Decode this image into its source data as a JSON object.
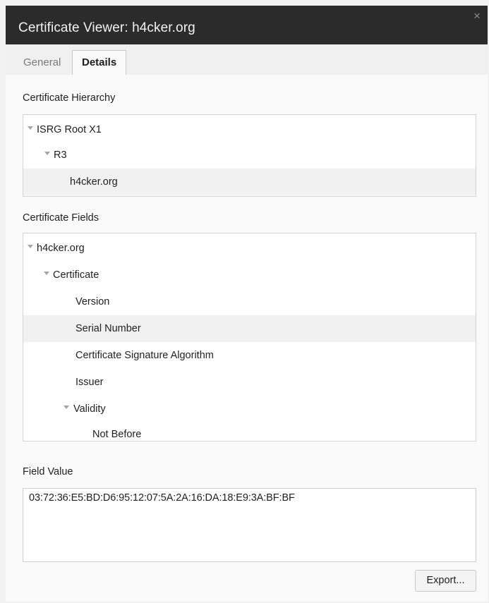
{
  "window": {
    "title": "Certificate Viewer: h4cker.org",
    "close_glyph": "×"
  },
  "tabs": [
    {
      "label": "General",
      "active": false
    },
    {
      "label": "Details",
      "active": true
    }
  ],
  "hierarchy": {
    "label": "Certificate Hierarchy",
    "items": [
      {
        "label": "ISRG Root X1",
        "expanded": true,
        "selected": false
      },
      {
        "label": "R3",
        "expanded": true,
        "selected": false
      },
      {
        "label": "h4cker.org",
        "expanded": false,
        "selected": true
      }
    ]
  },
  "fields": {
    "label": "Certificate Fields",
    "items": [
      {
        "label": "h4cker.org",
        "expanded": true,
        "selected": false
      },
      {
        "label": "Certificate",
        "expanded": true,
        "selected": false
      },
      {
        "label": "Version",
        "expanded": false,
        "selected": false
      },
      {
        "label": "Serial Number",
        "expanded": false,
        "selected": true
      },
      {
        "label": "Certificate Signature Algorithm",
        "expanded": false,
        "selected": false
      },
      {
        "label": "Issuer",
        "expanded": false,
        "selected": false
      },
      {
        "label": "Validity",
        "expanded": true,
        "selected": false
      },
      {
        "label": "Not Before",
        "expanded": false,
        "selected": false
      }
    ]
  },
  "field_value": {
    "label": "Field Value",
    "value": "03:72:36:E5:BD:D6:95:12:07:5A:2A:16:DA:18:E9:3A:BF:BF"
  },
  "export_button": {
    "label": "Export..."
  },
  "icons": {
    "expand": "disclosure-triangle-down-icon",
    "close": "close-icon"
  },
  "colors": {
    "titlebar": "#2b2b2b",
    "title_text": "#f2f2f2",
    "selected_row": "#f1f1f1",
    "panel": "#fafafa"
  }
}
